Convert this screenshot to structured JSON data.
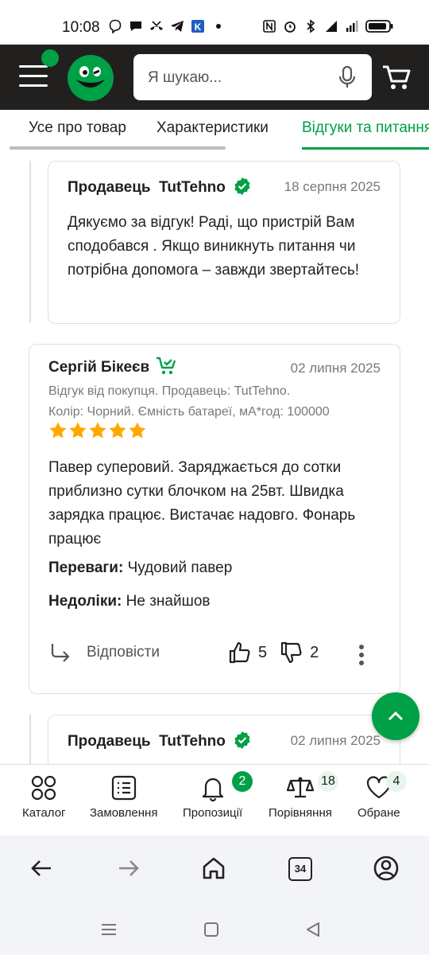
{
  "status_bar": {
    "time": "10:08",
    "left_icons": [
      "viber-icon",
      "chat-icon",
      "missed-call-icon",
      "telegram-icon",
      "kyivstar-icon",
      "dot-icon"
    ],
    "right_icons": [
      "nfc-icon",
      "alarm-icon",
      "bluetooth-icon",
      "signal-4g-icon",
      "signal-icon",
      "battery-icon"
    ]
  },
  "header": {
    "search_placeholder": "Я шукаю...",
    "colors": {
      "bg": "#221f1f",
      "accent": "#00a046"
    }
  },
  "tabs": [
    {
      "label": "Усе про товар"
    },
    {
      "label": "Характеристики"
    },
    {
      "label": "Відгуки та питання",
      "active": true
    }
  ],
  "replies": [
    {
      "label": "Продавець",
      "seller": "TutTehno",
      "date": "18 серпня 2025",
      "text": "Дякуємо за відгук! Раді, що пристрій Вам сподобався . Якщо виникнуть питання чи потрібна допомога – завжди звертайтесь!"
    },
    {
      "label": "Продавець",
      "seller": "TutTehno",
      "date": "02 липня 2025"
    }
  ],
  "review": {
    "author": "Сергій Бікеєв",
    "date": "02 липня 2025",
    "meta_line1": "Відгук від покупця. Продавець: TutTehno.",
    "meta_line2": "Колір: Чорний. Ємність батареї, мА*год: 100000",
    "rating": 5,
    "text": "Павер суперовий. Заряджається до сотки приблизно сутки блочком на 25вт. Швидка зарядка працює. Вистачає надовго. Фонарь працює",
    "pros_label": "Переваги:",
    "pros": "Чудовий павер",
    "cons_label": "Недоліки:",
    "cons": "Не знайшов",
    "reply_label": "Відповісти",
    "likes": "5",
    "dislikes": "2"
  },
  "bottom_nav": [
    {
      "label": "Каталог",
      "icon": "catalog-icon"
    },
    {
      "label": "Замовлення",
      "icon": "orders-icon"
    },
    {
      "label": "Пропозиції",
      "icon": "bell-icon",
      "badge": "2"
    },
    {
      "label": "Порівняння",
      "icon": "scales-icon",
      "badge": "18"
    },
    {
      "label": "Обране",
      "icon": "heart-icon",
      "badge": "4"
    }
  ],
  "browser": {
    "tab_count": "34"
  }
}
